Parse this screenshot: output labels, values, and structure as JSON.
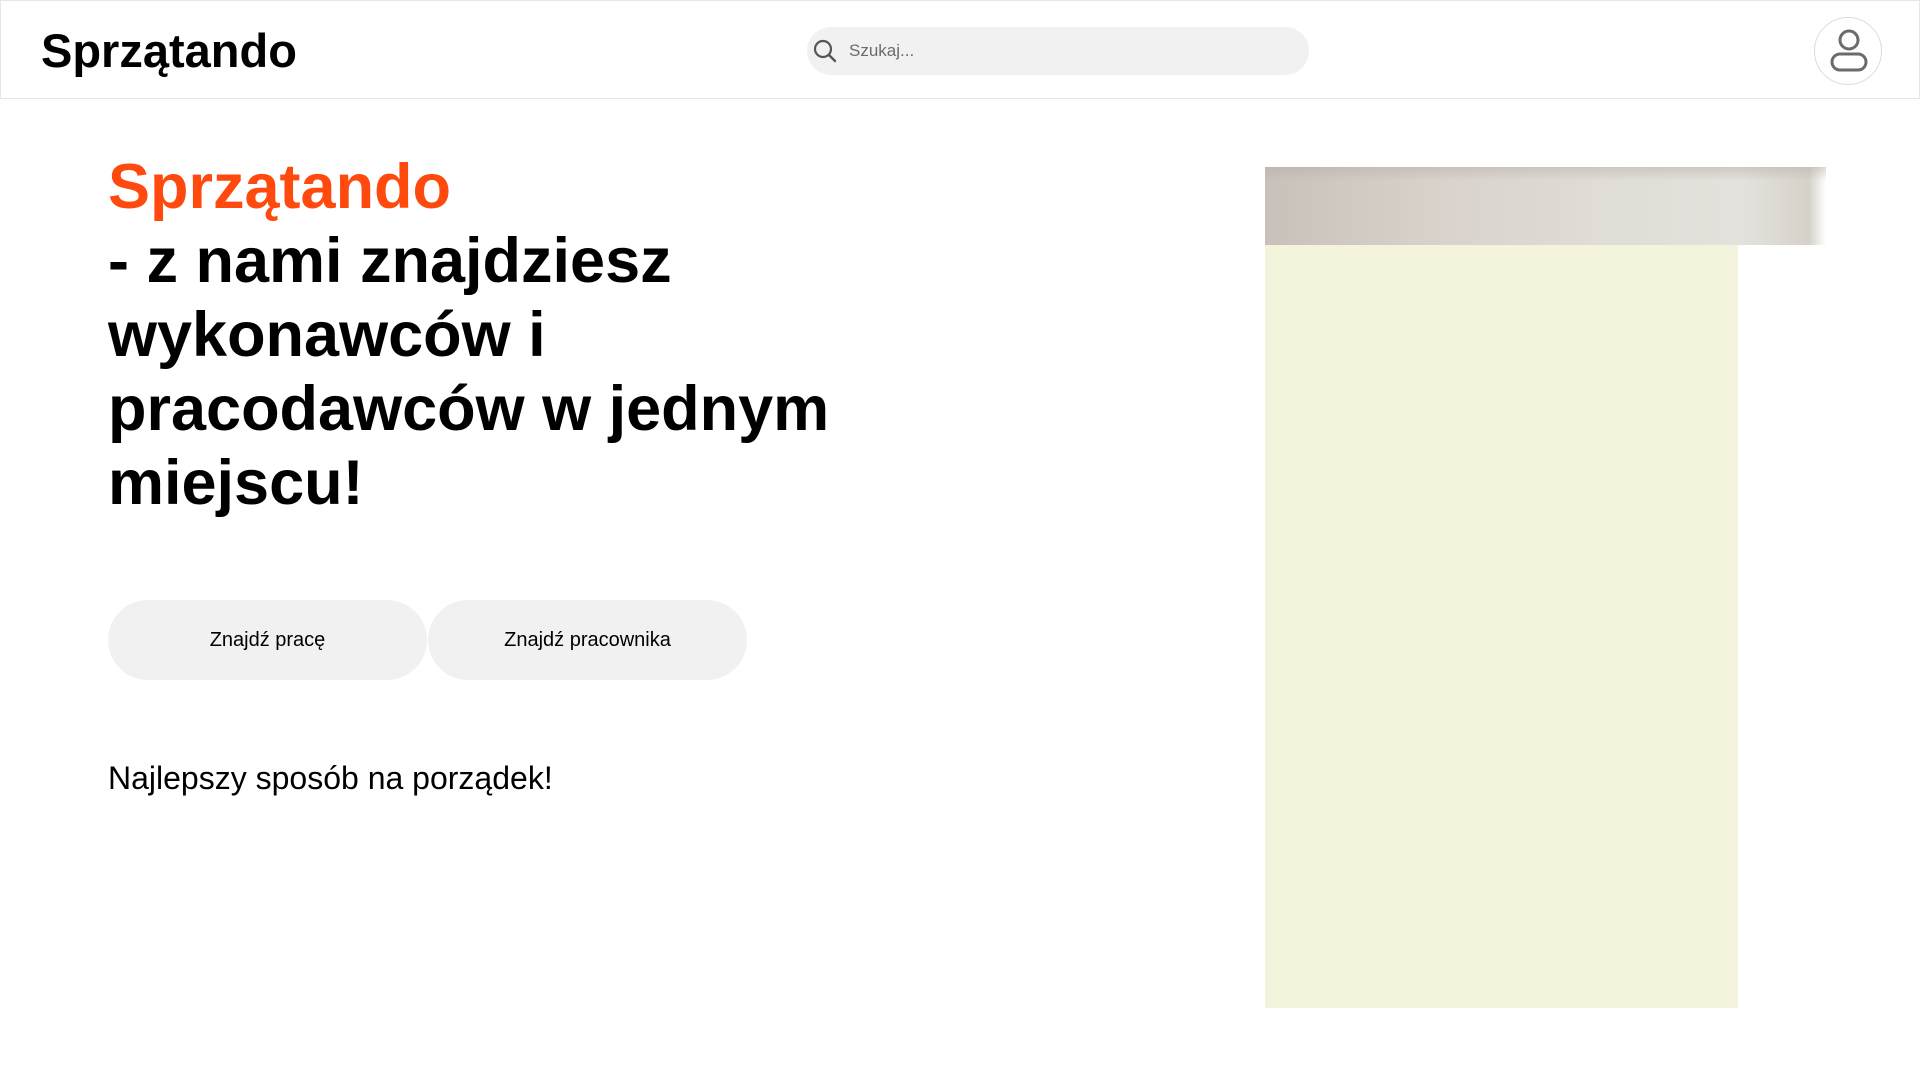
{
  "header": {
    "logo": "Sprzątando",
    "search": {
      "placeholder": "Szukaj...",
      "icon": "search-icon"
    },
    "profile_icon": "user-icon"
  },
  "hero": {
    "brand": "Sprzątando",
    "title": "- z nami znajdziesz wykonawców i pracodawców w jednym miejscu!",
    "buttons": {
      "find_job": "Znajdź pracę",
      "find_worker": "Znajdź pracownika"
    },
    "tagline": "Najlepszy sposób na porządek!"
  },
  "colors": {
    "accent": "#ff4a0f",
    "button_bg": "#f1f1f1",
    "panel_bg": "#f4f4dc"
  }
}
